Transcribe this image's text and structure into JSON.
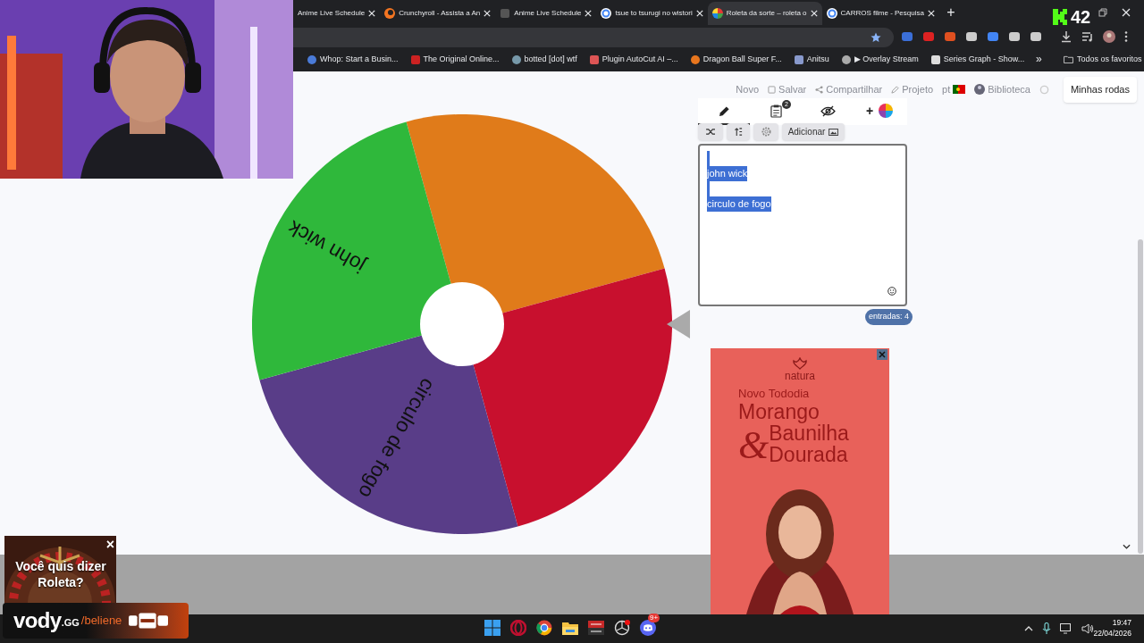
{
  "browser": {
    "tabs": [
      {
        "title": "Anime Live Schedule",
        "selected": false
      },
      {
        "title": "Crunchyroll - Assista a An",
        "selected": false
      },
      {
        "title": "Anime Live Schedule",
        "selected": false
      },
      {
        "title": "tsue to tsurugi no wistori",
        "selected": false
      },
      {
        "title": "Roleta da sorte – roleta o",
        "selected": true
      },
      {
        "title": "CARROS filme - Pesquisa",
        "selected": false
      }
    ],
    "new_tab": "+",
    "viewer_count": "42",
    "bookmarks": [
      "Whop: Start a Busin...",
      "The Original Online...",
      "botted [dot] wtf",
      "Plugin AutoCut AI –...",
      "Dragon Ball Super F...",
      "Anitsu",
      "▶ Overlay Stream",
      "Series Graph - Show..."
    ],
    "bookmarks_more": "»",
    "all_bookmarks": "Todos os favoritos"
  },
  "toolbar": {
    "items": [
      "Novo",
      "Salvar",
      "Compartilhar",
      "Projeto",
      "pt",
      "Biblioteca"
    ],
    "my_wheels": "Minhas rodas"
  },
  "wheel": {
    "slices": [
      {
        "color": "#e07b1a"
      },
      {
        "color": "#c8102e"
      },
      {
        "color": "#593d88",
        "label": "circulo de fogo"
      },
      {
        "color": "#2fb83b",
        "label": "john wick"
      }
    ]
  },
  "editor": {
    "tabs": [
      {
        "kind": "edit",
        "selected": true
      },
      {
        "kind": "results",
        "badge": "2",
        "selected": false
      },
      {
        "kind": "hide",
        "selected": false
      },
      {
        "kind": "color",
        "label": "+",
        "selected": false
      }
    ],
    "add_button": "Adicionar",
    "lines": [
      {
        "kind": "blank"
      },
      {
        "kind": "text",
        "text": "john wick"
      },
      {
        "kind": "blank"
      },
      {
        "kind": "text",
        "text": "circulo de fogo"
      }
    ],
    "count": "entradas: 4"
  },
  "ad": {
    "brand": "natura",
    "line1": "Novo Tododia",
    "line2": "Morango",
    "amp": "&",
    "line3": "Baunilha",
    "line4": "Dourada"
  },
  "overlay": {
    "prompt": "Você quis dizer Roleta?",
    "close": "×",
    "logo": "vody",
    "logo_suffix": ".GG",
    "handle": "/beliene"
  },
  "taskbar": {
    "time": "19:47",
    "date": "22/04/2026",
    "discord_badge": "9+"
  }
}
